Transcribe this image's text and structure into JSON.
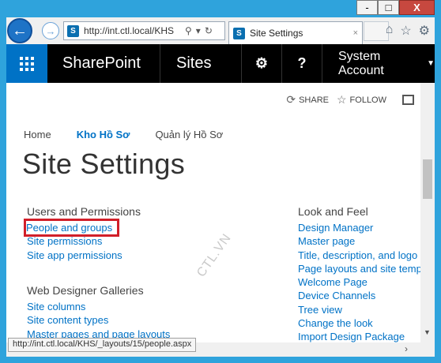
{
  "window": {
    "controls": [
      "-",
      "□",
      "X"
    ]
  },
  "browser": {
    "address": "http://int.ctl.local/KHS",
    "tab_title": "Site Settings",
    "tab_close": "×"
  },
  "suitebar": {
    "brand": "SharePoint",
    "sites": "Sites",
    "account": "System Account"
  },
  "actions": {
    "share": "SHARE",
    "follow": "FOLLOW"
  },
  "topnav": [
    "Home",
    "Kho Hồ Sơ",
    "Quản lý Hồ Sơ"
  ],
  "page_title": "Site Settings",
  "watermark": "CTL.VN",
  "sections": {
    "users": {
      "heading": "Users and Permissions",
      "links": [
        "People and groups",
        "Site permissions",
        "Site app permissions"
      ]
    },
    "web": {
      "heading": "Web Designer Galleries",
      "links": [
        "Site columns",
        "Site content types",
        "Master pages and page layouts"
      ]
    },
    "look": {
      "heading": "Look and Feel",
      "links": [
        "Design Manager",
        "Master page",
        "Title, description, and logo",
        "Page layouts and site temp",
        "Welcome Page",
        "Device Channels",
        "Tree view",
        "Change the look",
        "Import Design Package"
      ]
    }
  },
  "status_url": "http://int.ctl.local/KHS/_layouts/15/people.aspx",
  "colors": {
    "accent": "#0072c6",
    "highlight": "#d11f29",
    "suitebar": "#000000"
  }
}
